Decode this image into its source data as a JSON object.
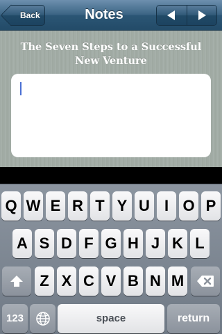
{
  "navbar": {
    "back_label": "Back",
    "title": "Notes",
    "prev_glyph": "◀",
    "next_glyph": "▶"
  },
  "note": {
    "title": "The Seven Steps to a Successful New Venture",
    "body_value": ""
  },
  "keyboard": {
    "rows": [
      [
        "Q",
        "W",
        "E",
        "R",
        "T",
        "Y",
        "U",
        "I",
        "O",
        "P"
      ],
      [
        "A",
        "S",
        "D",
        "F",
        "G",
        "H",
        "J",
        "K",
        "L"
      ],
      [
        "Z",
        "X",
        "C",
        "V",
        "B",
        "N",
        "M"
      ]
    ],
    "numbers_label": "123",
    "space_label": "space",
    "return_label": "return",
    "shift_icon": "shift-icon",
    "delete_icon": "backspace-icon",
    "globe_icon": "globe-icon"
  },
  "colors": {
    "navbar_base": "#2b5675",
    "caret": "#4a6fd3",
    "content_background": "#a3ada6"
  }
}
